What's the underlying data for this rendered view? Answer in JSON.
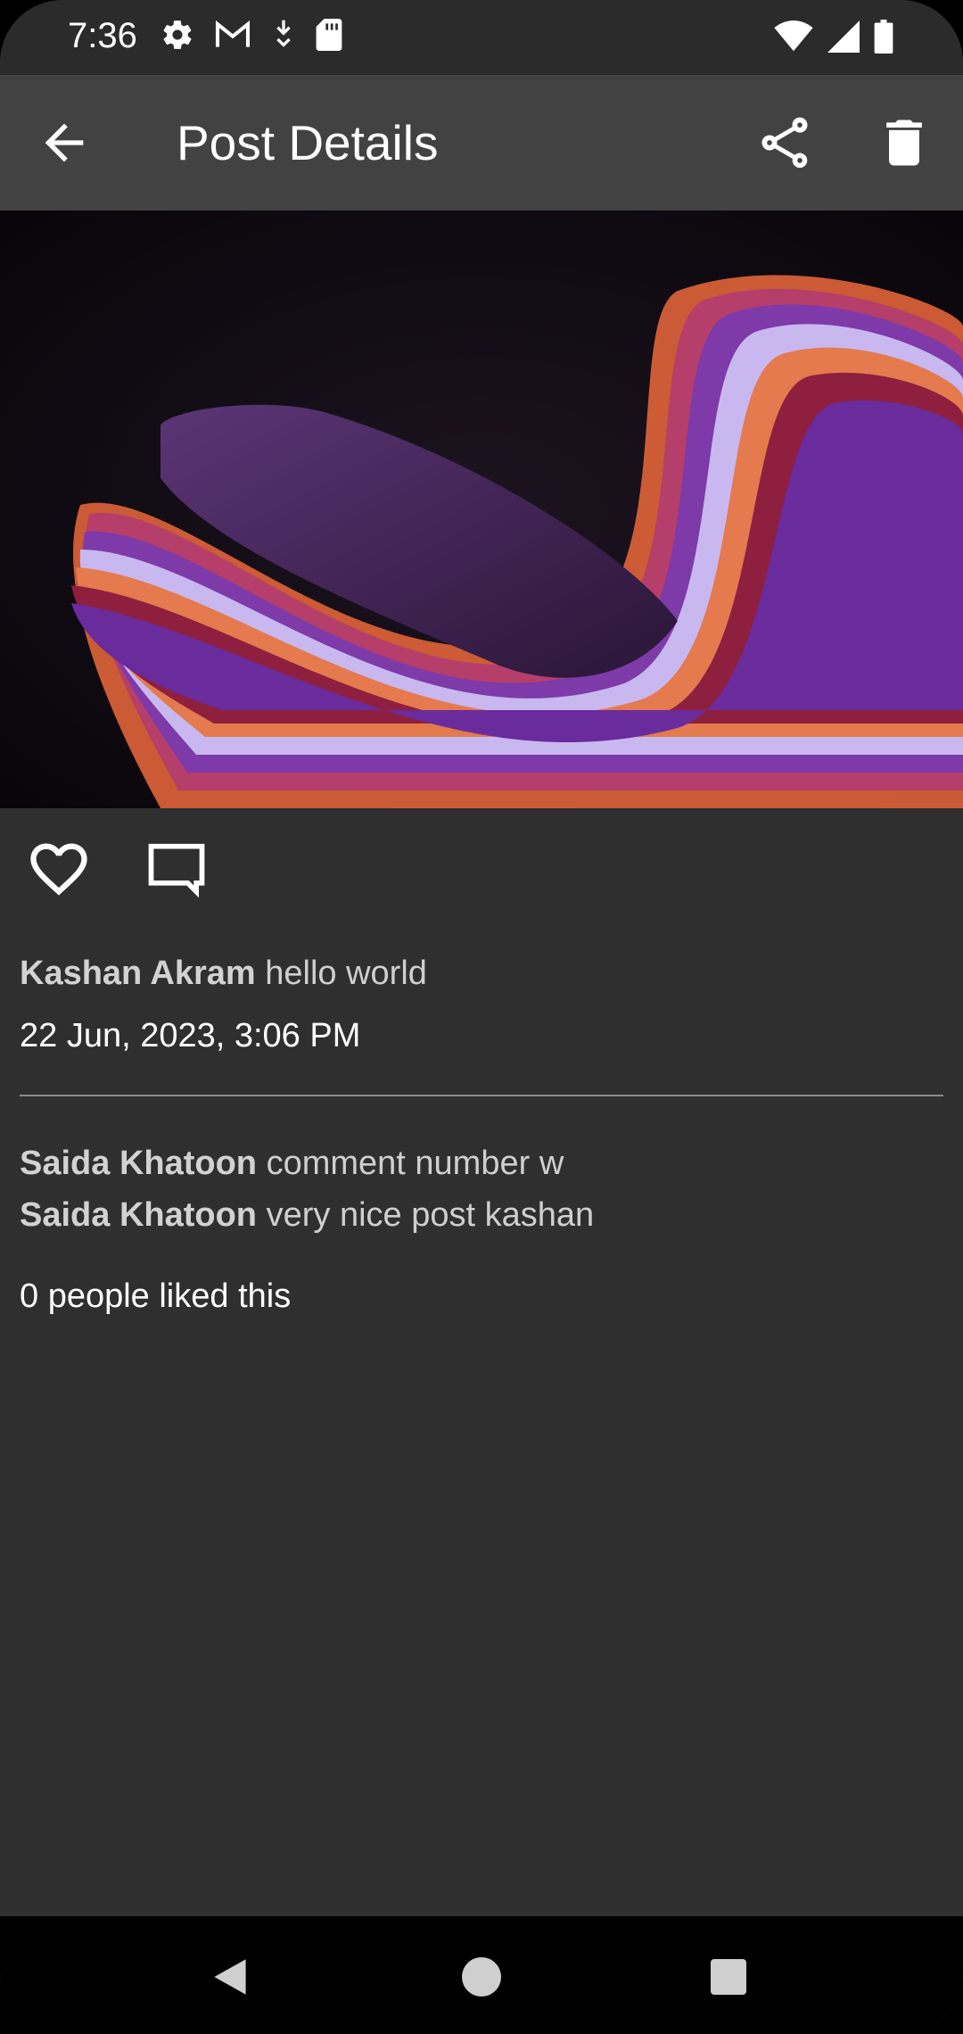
{
  "status_bar": {
    "time": "7:36",
    "left_icons": [
      "settings-icon",
      "gmail-icon",
      "download-icon",
      "sd-card-icon"
    ],
    "right_icons": [
      "wifi-icon",
      "signal-icon",
      "battery-icon"
    ]
  },
  "app_bar": {
    "title": "Post Details",
    "back_icon": "arrow-back-icon",
    "share_icon": "share-icon",
    "delete_icon": "delete-icon"
  },
  "post": {
    "image": "abstract-colorful-wave-image",
    "author": "Kashan Akram",
    "caption": "hello world",
    "date": "22 Jun, 2023, 3:06 PM",
    "like_icon": "heart-outline-icon",
    "comment_icon": "comment-outline-icon"
  },
  "comments": [
    {
      "author": "Saida Khatoon",
      "text": "comment number w"
    },
    {
      "author": "Saida Khatoon",
      "text": "very nice post kashan"
    }
  ],
  "likes_text": "0 people liked this",
  "colors": {
    "background": "#2f2f2f",
    "app_bar": "#424242",
    "status_bar": "#2b2b2b",
    "nav_bar": "#000000"
  }
}
